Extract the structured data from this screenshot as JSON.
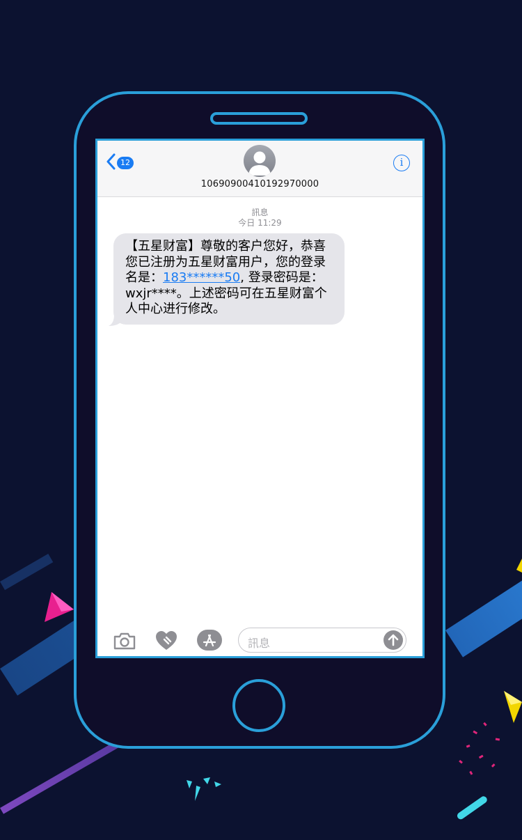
{
  "header": {
    "back_badge": "12",
    "contact_number": "10690900410192970000",
    "info_glyph": "i"
  },
  "thread": {
    "service_label": "訊息",
    "timestamp": "今日 11:29",
    "message": {
      "text_before": "【五星财富】尊敬的客户您好，恭喜您已注册为五星财富用户，您的登录名是：",
      "link": "183******50",
      "text_after": ", 登录密码是：wxjr****。上述密码可在五星财富个人中心进行修改。"
    }
  },
  "composer": {
    "placeholder": "訊息",
    "icons": [
      "camera-icon",
      "digital-touch-icon",
      "app-store-icon",
      "send-arrow-icon"
    ]
  },
  "colors": {
    "background": "#0c1230",
    "phone_outline": "#2a9fd9",
    "accent_blue": "#1a7cf3",
    "bubble_gray": "#e5e5ea"
  }
}
